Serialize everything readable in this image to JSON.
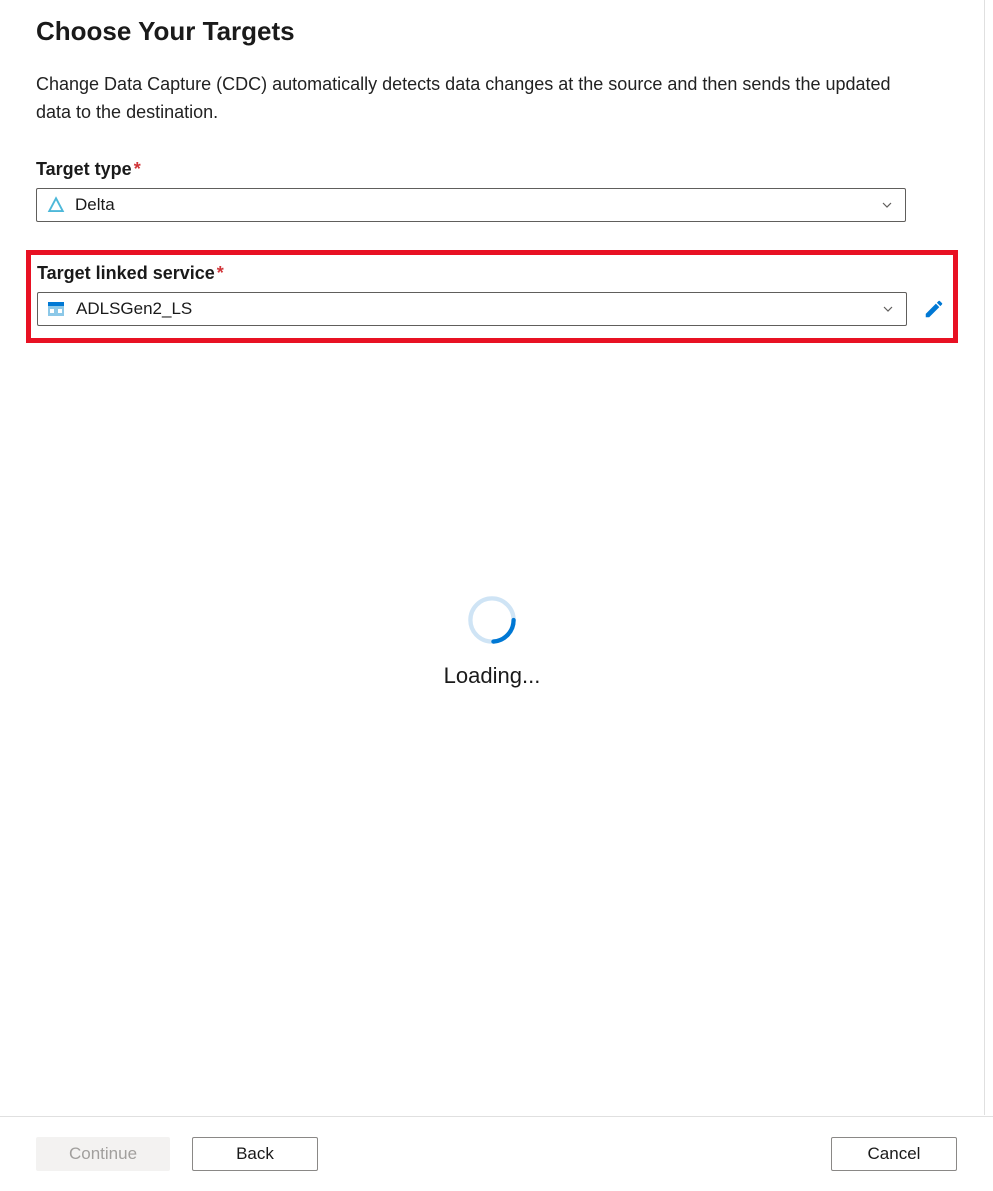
{
  "header": {
    "title": "Choose Your Targets"
  },
  "description": "Change Data Capture (CDC) automatically detects data changes at the source and then sends the updated data to the destination.",
  "fields": {
    "targetType": {
      "label": "Target type",
      "value": "Delta"
    },
    "linkedService": {
      "label": "Target linked service",
      "value": "ADLSGen2_LS"
    }
  },
  "loading": {
    "text": "Loading..."
  },
  "footer": {
    "continue": "Continue",
    "back": "Back",
    "cancel": "Cancel"
  }
}
